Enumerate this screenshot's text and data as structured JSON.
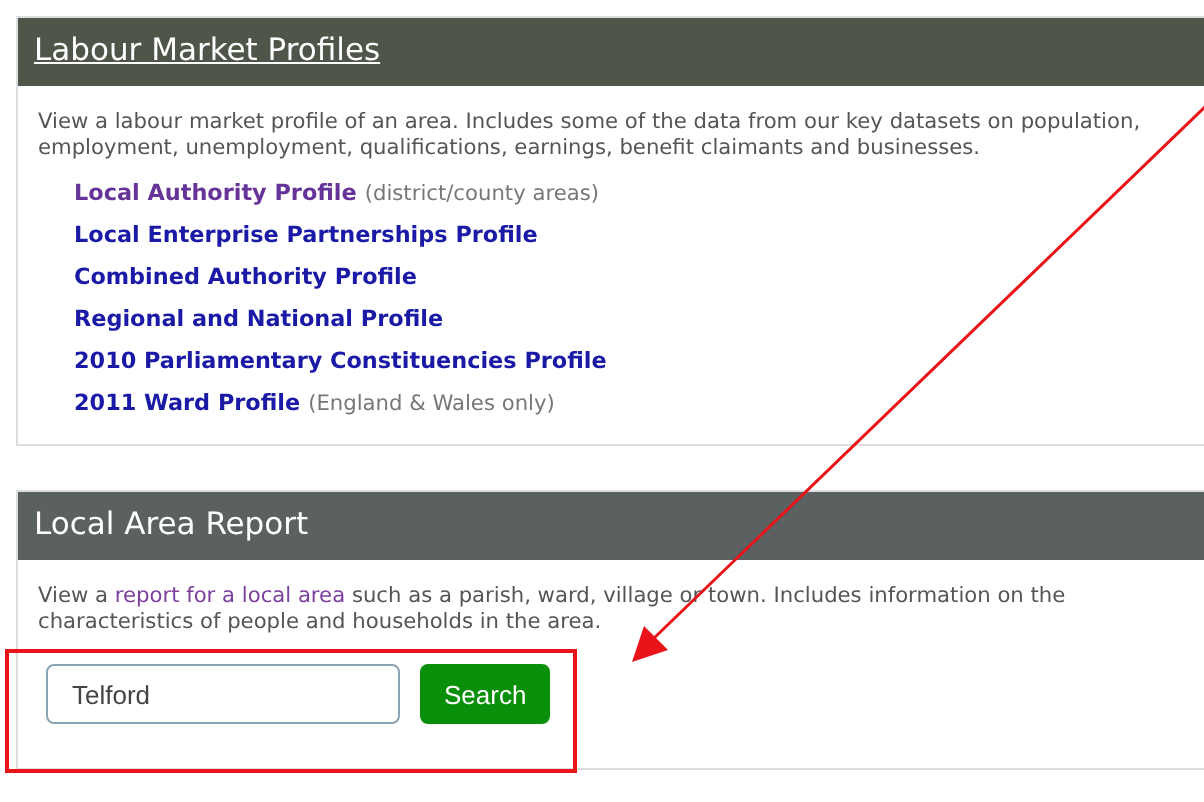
{
  "sections": [
    {
      "title": "Labour Market Profiles",
      "title_is_link": true,
      "kind": "links",
      "description": "View a labour market profile of an area. Includes some of the data from our key datasets on population, employment, unemployment, qualifications, earnings, benefit claimants and businesses.",
      "links": [
        {
          "label": "Local Authority Profile",
          "note": "(district/county areas)",
          "visited": true
        },
        {
          "label": "Local Enterprise Partnerships Profile",
          "visited": false
        },
        {
          "label": "Combined Authority Profile",
          "visited": false
        },
        {
          "label": "Regional and National Profile",
          "visited": false
        },
        {
          "label": "2010 Parliamentary Constituencies Profile",
          "visited": false
        },
        {
          "label": "2011 Ward Profile",
          "note": "(England & Wales only)",
          "visited": false
        }
      ]
    },
    {
      "title": "Local Area Report",
      "title_is_link": false,
      "kind": "search",
      "description_parts": {
        "before": "View a ",
        "link": "report for a local area",
        "after": " such as a parish, ward, village or town. Includes information on the characteristics of people and households in the area."
      },
      "search": {
        "value": "Telford",
        "button": "Search"
      }
    }
  ]
}
